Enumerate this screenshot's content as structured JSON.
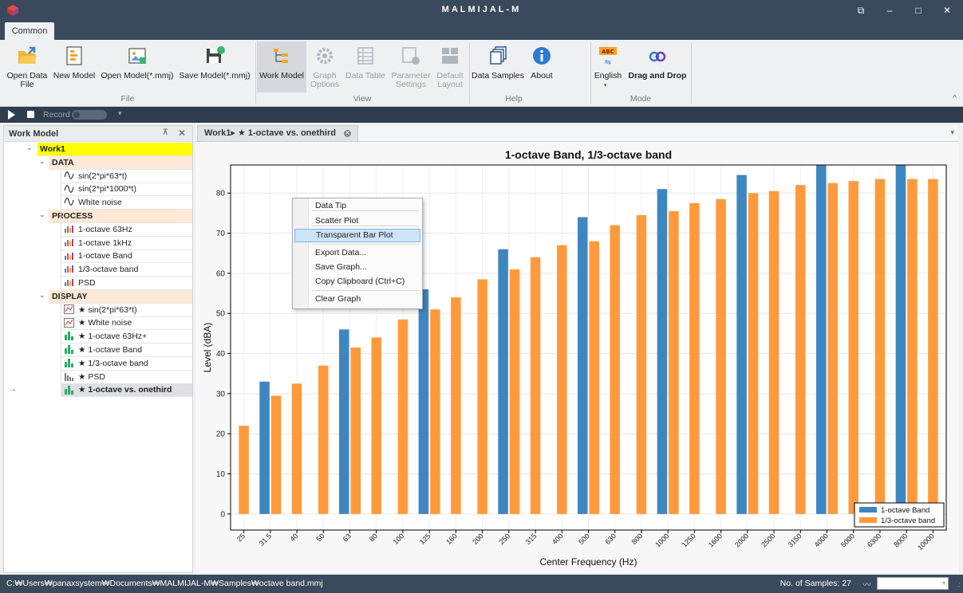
{
  "window": {
    "title": "MALMIJAL-M",
    "btn_restore": "⧉",
    "btn_min": "–",
    "btn_max": "□",
    "btn_close": "✕"
  },
  "ribbon": {
    "tab": "Common",
    "buttons": {
      "open_data_file": "Open Data File",
      "new_model": "New Model",
      "open_model": "Open Model(*.mmj)",
      "save_model": "Save Model(*.mmj)",
      "work_model": "Work Model",
      "graph_options": "Graph Options",
      "data_table": "Data Table",
      "parameter_settings": "Parameter Settings",
      "default_layout": "Default Layout",
      "data_samples": "Data Samples",
      "about": "About",
      "english": "English",
      "drag_and_drop": "Drag and Drop"
    },
    "groups": {
      "file": "File",
      "view": "View",
      "help": "Help",
      "mode": "Mode"
    },
    "collapse_glyph": "^"
  },
  "recordbar": {
    "label": "Record",
    "caret": "▾"
  },
  "leftpanel": {
    "title": "Work Model",
    "pin": "⊼",
    "close": "✕",
    "root": "Work1",
    "sections": [
      {
        "name": "DATA",
        "items": [
          "sin(2*pi*63*t)",
          "sin(2*pi*1000*t)",
          "White noise"
        ]
      },
      {
        "name": "PROCESS",
        "items": [
          "1-octave 63Hz",
          "1-octave 1kHz",
          "1-octave Band",
          "1/3-octave band",
          "PSD"
        ]
      },
      {
        "name": "DISPLAY",
        "items": [
          "★ sin(2*pi*63*t)",
          "★ White noise",
          "★ 1-octave 63Hz+",
          "★ 1-octave Band",
          "★ 1/3-octave band",
          "★ PSD",
          "★ 1-octave vs. onethird"
        ]
      }
    ],
    "current_arrow": "→"
  },
  "doc": {
    "tab_label": "Work1▸ ★ 1-octave vs. onethird",
    "menu_glyph": "▾"
  },
  "context_menu": {
    "items": [
      "Data Tip",
      "Scatter Plot",
      "Transparent Bar Plot",
      "Export Data...",
      "Save Graph...",
      "Copy Clipboard (Ctrl+C)",
      "Clear Graph"
    ],
    "highlighted": "Transparent Bar Plot"
  },
  "colors": {
    "series1": "#3e86c0",
    "series2": "#ff9a3c",
    "titlebar": "#3a4a5c",
    "tree_section": "#fde9d6",
    "tree_root": "#ffff00"
  },
  "chart_data": {
    "type": "bar",
    "title": "1-octave Band, 1/3-octave band",
    "xlabel": "Center Frequency (Hz)",
    "ylabel": "Level (dBA)",
    "ylim": [
      -4,
      87
    ],
    "yticks": [
      0,
      10,
      20,
      30,
      40,
      50,
      60,
      70,
      80
    ],
    "categories": [
      "25",
      "31.5",
      "40",
      "50",
      "63",
      "80",
      "100",
      "125",
      "160",
      "200",
      "250",
      "315",
      "400",
      "500",
      "630",
      "800",
      "1000",
      "1250",
      "1600",
      "2000",
      "2500",
      "3150",
      "4000",
      "5000",
      "6300",
      "8000",
      "10000"
    ],
    "series": [
      {
        "name": "1-octave Band",
        "values": [
          null,
          33,
          null,
          null,
          46,
          null,
          null,
          56,
          null,
          null,
          66,
          null,
          null,
          74,
          null,
          null,
          81,
          null,
          null,
          84.5,
          null,
          null,
          87,
          null,
          null,
          87,
          null
        ]
      },
      {
        "name": "1/3-octave band",
        "values": [
          22,
          29.5,
          32.5,
          37,
          41.5,
          44,
          48.5,
          51,
          54,
          58.5,
          61,
          64,
          67,
          68,
          72,
          74.5,
          75.5,
          77.5,
          78.5,
          80,
          80.5,
          82,
          82.5,
          83,
          83.5,
          83.5,
          83.5
        ]
      }
    ],
    "grid": true,
    "legend_position": "bottom-right"
  },
  "status": {
    "path": "C:₩Users₩panaxsystem₩Documents₩MALMIJAL-M₩Samples₩octave band.mmj",
    "samples": "No. of Samples: 27",
    "wave": "〰",
    "grip": ".:"
  }
}
